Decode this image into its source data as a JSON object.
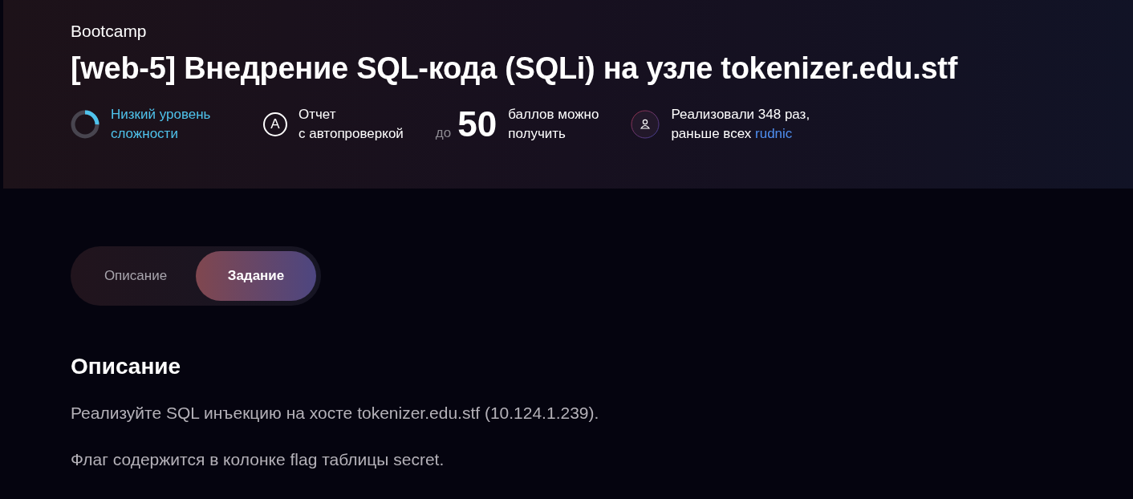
{
  "header": {
    "category": "Bootcamp",
    "title": "[web-5] Внедрение SQL-кода (SQLi) на узле tokenizer.edu.stf",
    "difficulty": {
      "label": "Низкий уровень сложности",
      "level": 0.25
    },
    "report": {
      "icon_letter": "A",
      "label_line_1": "Отчет",
      "label_line_2": "с автопроверкой"
    },
    "points": {
      "prefix": "до",
      "value": "50",
      "label_line_1": "баллов можно",
      "label_line_2": "получить"
    },
    "completions": {
      "line_1": "Реализовали 348 раз,",
      "line_2": "раньше всех",
      "first_user": "rudnic"
    }
  },
  "tabs": [
    {
      "label": "Описание",
      "selected": false
    },
    {
      "label": "Задание",
      "selected": true
    }
  ],
  "section": {
    "heading": "Описание",
    "paragraphs": [
      "Реализуйте SQL инъекцию на хосте tokenizer.edu.stf (10.124.1.239).",
      "Флаг содержится в колонке flag таблицы secret."
    ]
  }
}
